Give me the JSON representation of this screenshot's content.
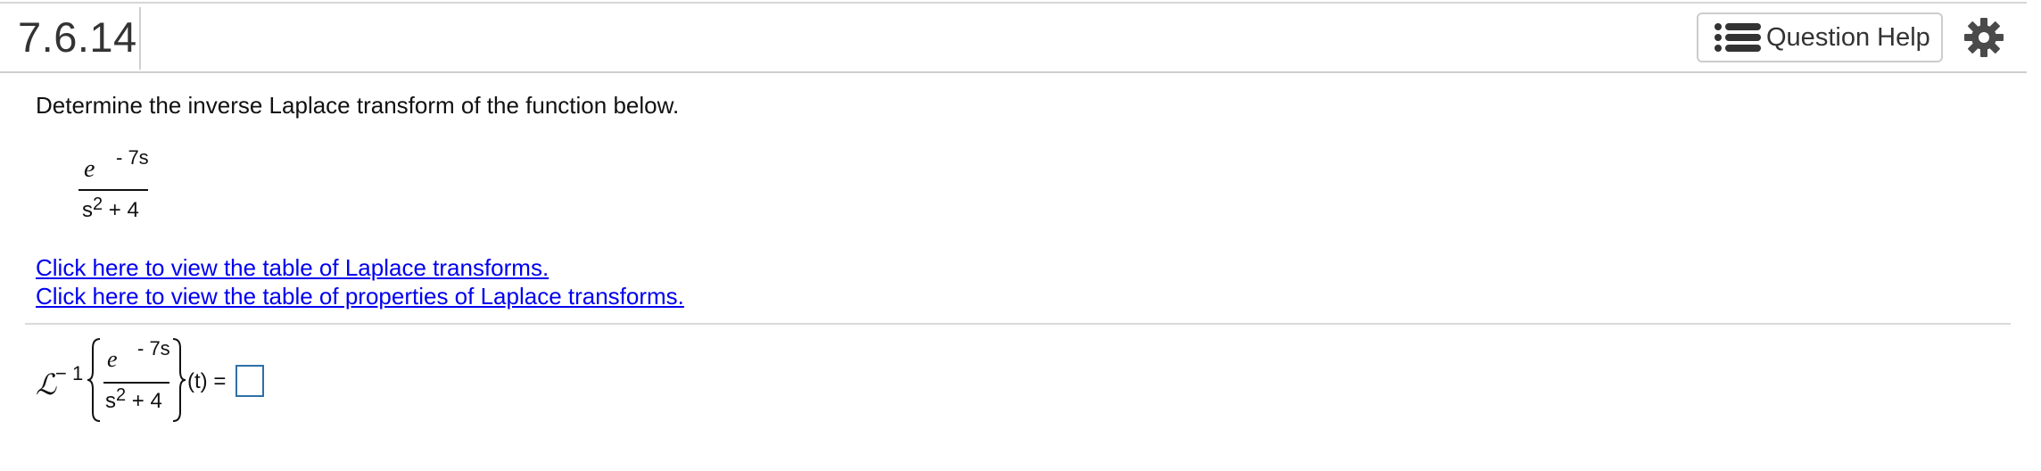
{
  "header": {
    "problem_number": "7.6.14",
    "help_button_label": "Question Help",
    "help_icon": "list-icon",
    "settings_icon": "gear-icon"
  },
  "question": {
    "prompt": "Determine the inverse Laplace transform of the function below.",
    "function": {
      "numerator_base": "e",
      "numerator_exponent": "- 7s",
      "denominator_base": "s",
      "denominator_power": "2",
      "denominator_rest": "+ 4"
    }
  },
  "links": {
    "table_transforms": "Click here to view the table of Laplace transforms.",
    "table_properties": "Click here to view the table of properties of Laplace transforms."
  },
  "answer": {
    "operator": "ℒ",
    "operator_exponent": "− 1",
    "numerator_base": "e",
    "numerator_exponent": "- 7s",
    "denominator_base": "s",
    "denominator_power": "2",
    "denominator_rest": "+ 4",
    "argument": "(t) =",
    "value": ""
  },
  "colors": {
    "link": "#0000ee",
    "answer_box_border": "#2f6fa7",
    "divider": "#cfcfcf"
  }
}
